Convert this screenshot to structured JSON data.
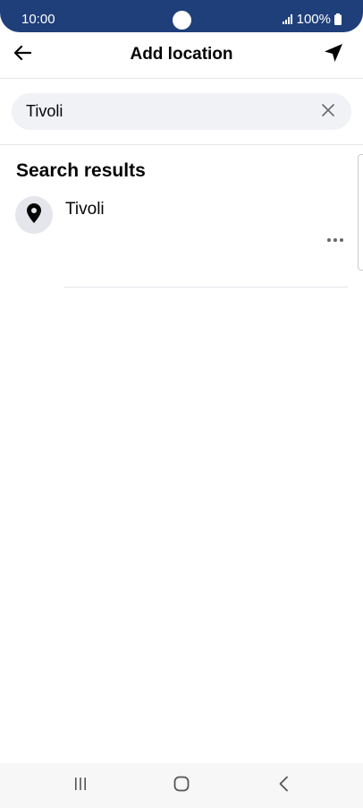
{
  "status_bar": {
    "time": "10:00",
    "battery": "100%",
    "icons": [
      "signal-icon",
      "battery-icon"
    ]
  },
  "header": {
    "title": "Add location",
    "back_icon": "arrow-left-icon",
    "locate_icon": "navigation-arrow-icon"
  },
  "search": {
    "value": "Tivoli",
    "clear_icon": "close-icon"
  },
  "results": {
    "heading": "Search results",
    "items": [
      {
        "name": "Tivoli",
        "icon": "location-pin-icon",
        "more_icon": "more-dots-icon"
      }
    ]
  },
  "nav_bar": {
    "icons": [
      "recent-apps-icon",
      "home-icon",
      "back-nav-icon"
    ]
  },
  "colors": {
    "status_bar": "#1f3f7a",
    "search_bg": "#f0f2f5",
    "pin_bg": "#e4e6eb",
    "divider": "#e4e6eb",
    "nav_bar": "#f7f7f7"
  }
}
